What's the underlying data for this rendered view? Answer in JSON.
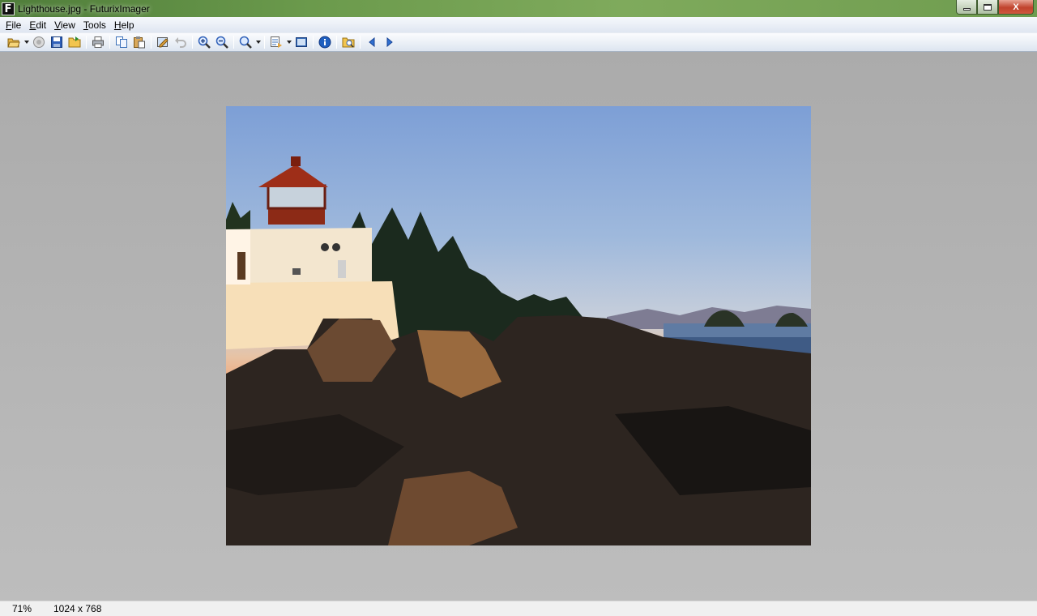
{
  "window": {
    "title": "Lighthouse.jpg - FuturixImager",
    "app_icon_letter": "F",
    "close_glyph": "X"
  },
  "menu": {
    "items": [
      "File",
      "Edit",
      "View",
      "Tools",
      "Help"
    ]
  },
  "toolbar": {
    "icons": [
      "open-folder-icon",
      "stop-icon",
      "save-icon",
      "open-folder-yellow-icon",
      "print-icon",
      "copy-icon",
      "paste-icon",
      "edit-image-icon",
      "undo-icon",
      "zoom-in-icon",
      "zoom-out-icon",
      "zoom-icon",
      "transform-icon",
      "fullscreen-icon",
      "info-icon",
      "browse-folder-icon",
      "previous-arrow-icon",
      "next-arrow-icon"
    ]
  },
  "status": {
    "zoom": "71%",
    "dimensions": "1024 x 768"
  },
  "colors": {
    "titlebar": "#6b9a4c",
    "viewport_bg": "#b3b3b3",
    "accent_blue": "#1f5fbf"
  }
}
